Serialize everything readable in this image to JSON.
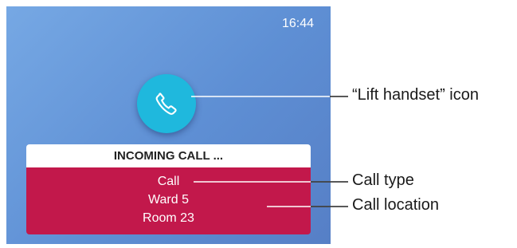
{
  "screen": {
    "time": "16:44",
    "handset_icon": "phone-handset-icon",
    "notification": {
      "header": "INCOMING CALL ...",
      "lines": [
        "Call",
        "Ward 5",
        "Room 23"
      ]
    }
  },
  "callouts": {
    "handset": "“Lift handset” icon",
    "call_type": "Call type",
    "call_location": "Call location"
  },
  "colors": {
    "screen_bg": "#6a9ada",
    "handset_button": "#1fb8dd",
    "notification_body": "#c2184b"
  }
}
